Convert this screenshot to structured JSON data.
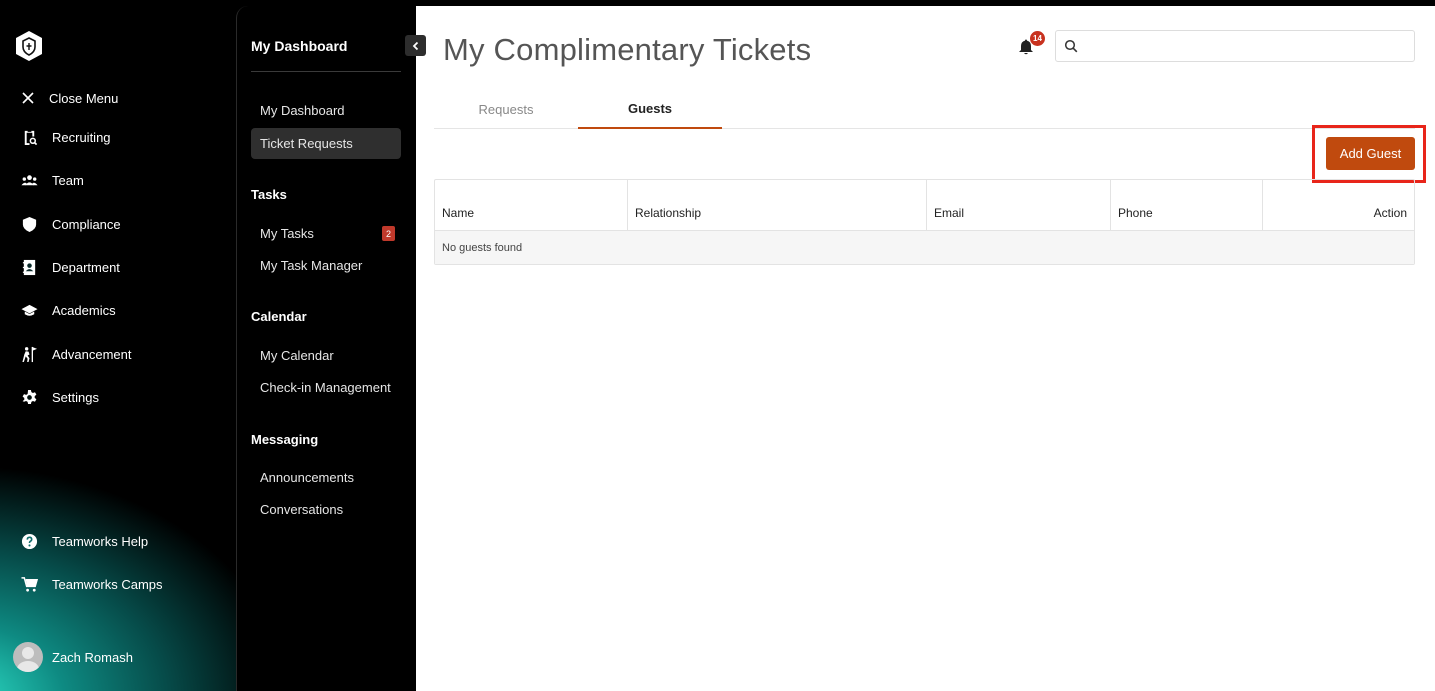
{
  "primary_nav": {
    "close_menu": "Close Menu",
    "items": [
      {
        "label": "Recruiting",
        "icon": "clipboard-search-icon"
      },
      {
        "label": "Team",
        "icon": "people-icon"
      },
      {
        "label": "Compliance",
        "icon": "shield-icon"
      },
      {
        "label": "Department",
        "icon": "contact-card-icon"
      },
      {
        "label": "Academics",
        "icon": "graduation-cap-icon"
      },
      {
        "label": "Advancement",
        "icon": "climber-flag-icon"
      },
      {
        "label": "Settings",
        "icon": "gear-icon"
      }
    ],
    "help_items": [
      {
        "label": "Teamworks Help",
        "icon": "help-icon"
      },
      {
        "label": "Teamworks Camps",
        "icon": "cart-icon"
      }
    ],
    "user_name": "Zach Romash"
  },
  "secondary_nav": {
    "title": "My Dashboard",
    "dashboard_items": [
      "My Dashboard",
      "Ticket Requests"
    ],
    "tasks_label": "Tasks",
    "tasks_items": [
      "My Tasks",
      "My Task Manager"
    ],
    "tasks_count": "2",
    "calendar_label": "Calendar",
    "calendar_items": [
      "My Calendar",
      "Check-in Management"
    ],
    "messaging_label": "Messaging",
    "messaging_items": [
      "Announcements",
      "Conversations"
    ]
  },
  "header": {
    "title": "My Complimentary Tickets",
    "notification_count": "14",
    "search_placeholder": "",
    "search_value": ""
  },
  "tabs": [
    {
      "label": "Requests",
      "active": false
    },
    {
      "label": "Guests",
      "active": true
    }
  ],
  "add_guest_label": "Add Guest",
  "table": {
    "columns": [
      "Name",
      "Relationship",
      "Email",
      "Phone",
      "Action"
    ],
    "empty_text": "No guests found"
  },
  "colors": {
    "accent": "#c04a0e",
    "highlight_box": "#e8251a",
    "badge": "#c8321f"
  }
}
